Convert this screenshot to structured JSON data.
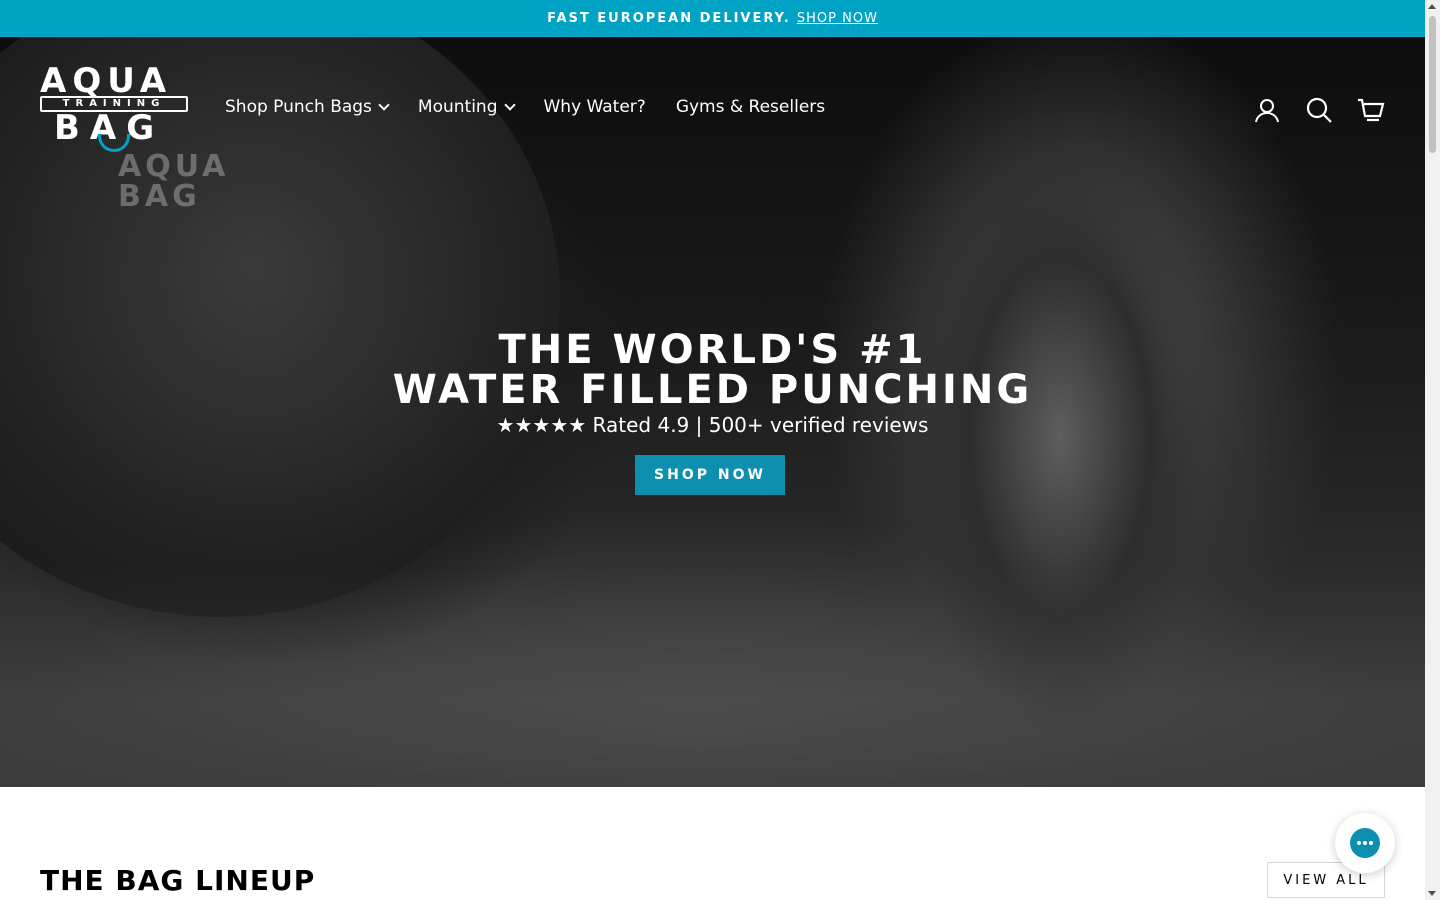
{
  "announcement": {
    "text": "FAST EUROPEAN DELIVERY.",
    "link": "SHOP NOW"
  },
  "logo": {
    "line1": "AQUA",
    "line2": "TRAINING",
    "line3": "BAG",
    "alt": "Aqua Training Bag"
  },
  "nav": {
    "items": [
      {
        "label": "Shop Punch Bags",
        "dropdown": true
      },
      {
        "label": "Mounting",
        "dropdown": true
      },
      {
        "label": "Why Water?",
        "dropdown": false
      },
      {
        "label": "Gyms & Resellers",
        "dropdown": false
      }
    ]
  },
  "header_icons": [
    "account-icon",
    "search-icon",
    "cart-icon"
  ],
  "hero": {
    "title_line1": "THE WORLD'S #1",
    "title_line2": "WATER FILLED PUNCHING",
    "subtitle": "★★★★★ Rated 4.9 | 500+ verified reviews",
    "button": "SHOP NOW",
    "bag_logo_line1": "AQUA",
    "bag_logo_line2": "BAG"
  },
  "lineup": {
    "title": "THE BAG LINEUP",
    "view_all": "VIEW ALL"
  },
  "colors": {
    "accent": "#00a3c4",
    "button": "#0d8fb0"
  }
}
